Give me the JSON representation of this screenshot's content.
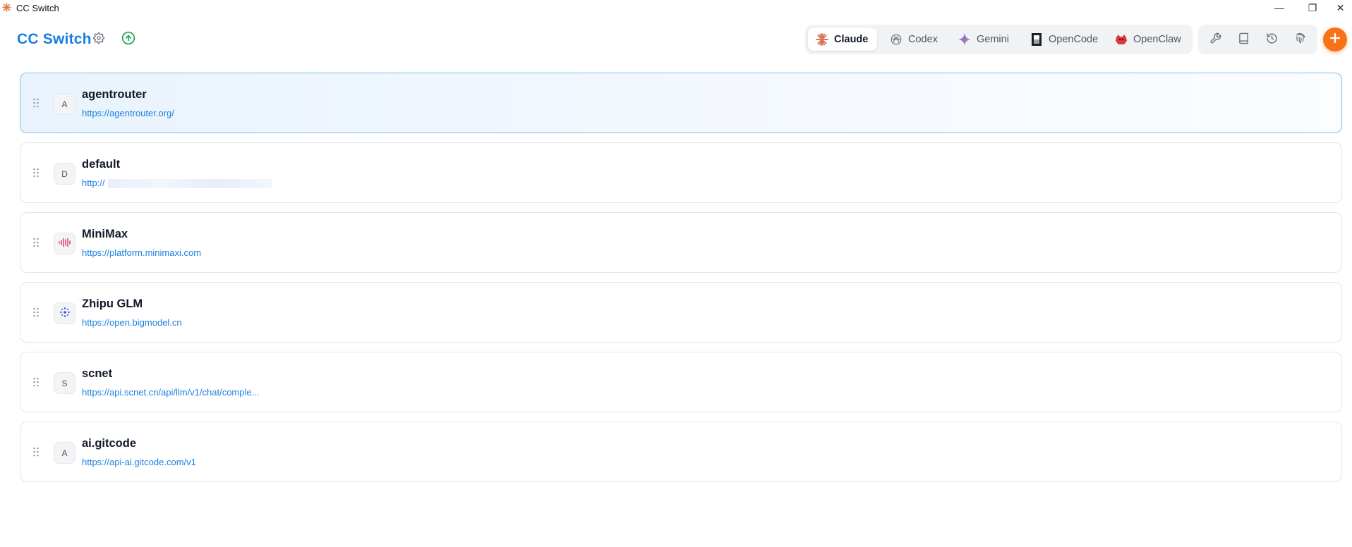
{
  "window": {
    "title": "CC Switch",
    "controls": {
      "minimize": "—",
      "maximize": "❐",
      "close": "✕"
    }
  },
  "header": {
    "brand": "CC Switch",
    "settings_icon": "gear-icon",
    "update_icon": "arrow-up-circle-icon",
    "update_color": "#16a34a"
  },
  "app_tabs": [
    {
      "label": "Claude",
      "icon": "claude-sunburst-icon",
      "active": true
    },
    {
      "label": "Codex",
      "icon": "openai-knot-icon",
      "active": false
    },
    {
      "label": "Gemini",
      "icon": "gemini-sparkle-icon",
      "active": false
    },
    {
      "label": "OpenCode",
      "icon": "opencode-square-icon",
      "active": false
    },
    {
      "label": "OpenClaw",
      "icon": "openclaw-crab-icon",
      "active": false
    }
  ],
  "tools": [
    "wrench-icon",
    "book-icon",
    "history-icon",
    "fingerprint-icon"
  ],
  "add_button": {
    "icon": "plus-icon",
    "color": "#f97316"
  },
  "providers": [
    {
      "name": "agentrouter",
      "url": "https://agentrouter.org/",
      "avatar": "A",
      "active": true
    },
    {
      "name": "default",
      "url": "http://",
      "avatar": "D",
      "active": false,
      "url_redacted": true
    },
    {
      "name": "MiniMax",
      "url": "https://platform.minimaxi.com",
      "avatar": "minimax-wave-icon",
      "active": false
    },
    {
      "name": "Zhipu GLM",
      "url": "https://open.bigmodel.cn",
      "avatar": "zhipu-dots-icon",
      "active": false
    },
    {
      "name": "scnet",
      "url": "https://api.scnet.cn/api/llm/v1/chat/comple...",
      "avatar": "S",
      "active": false
    },
    {
      "name": "ai.gitcode",
      "url": "https://api-ai.gitcode.com/v1",
      "avatar": "A",
      "active": false
    }
  ],
  "colors": {
    "accent": "#1a7fe0",
    "active_border": "#7cbdf1",
    "active_bg": "#e9f3fd"
  }
}
